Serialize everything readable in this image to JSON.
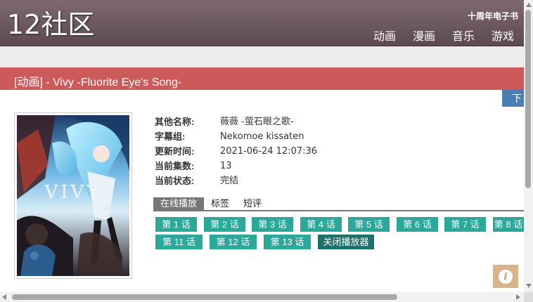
{
  "header": {
    "logo": "12社区",
    "promo": "十周年电子书",
    "nav": [
      "动画",
      "漫画",
      "音乐",
      "游戏"
    ]
  },
  "title": "[动画] - Vivy -Fluorite Eye's Song-",
  "download_tab": "下",
  "poster": {
    "title_text": "VIVY",
    "subtitle_text": "Fluorite Eye's Song"
  },
  "info": [
    {
      "label": "其他名称:",
      "value": "薇薇 -萤石眼之歌-"
    },
    {
      "label": "字幕组:",
      "value": "Nekomoe kissaten"
    },
    {
      "label": "更新时间:",
      "value": "2021-06-24 12:07:36"
    },
    {
      "label": "当前集数:",
      "value": "13"
    },
    {
      "label": "当前状态:",
      "value": "完结"
    }
  ],
  "tabs": [
    {
      "label": "在线播放",
      "active": true
    },
    {
      "label": "标签",
      "active": false
    },
    {
      "label": "短评",
      "active": false
    }
  ],
  "episodes": [
    "第 1 话",
    "第 2 话",
    "第 3 话",
    "第 4 话",
    "第 5 话",
    "第 6 话",
    "第 7 话",
    "第 8 话",
    "第 11 话",
    "第 12 话",
    "第 13 话"
  ],
  "close_player": "关闭播放器",
  "info_icon": "i",
  "colors": {
    "header": "#6f5c62",
    "title_bar": "#cd5a5a",
    "episode": "#2ca89a",
    "close_button": "#1f6f6a",
    "download_tab": "#4a7fb3",
    "info_button": "#d8b48c"
  },
  "icons": [
    "info-icon",
    "scroll-arrow-up-icon",
    "scroll-arrow-down-icon",
    "scroll-arrow-left-icon",
    "scroll-arrow-right-icon"
  ]
}
